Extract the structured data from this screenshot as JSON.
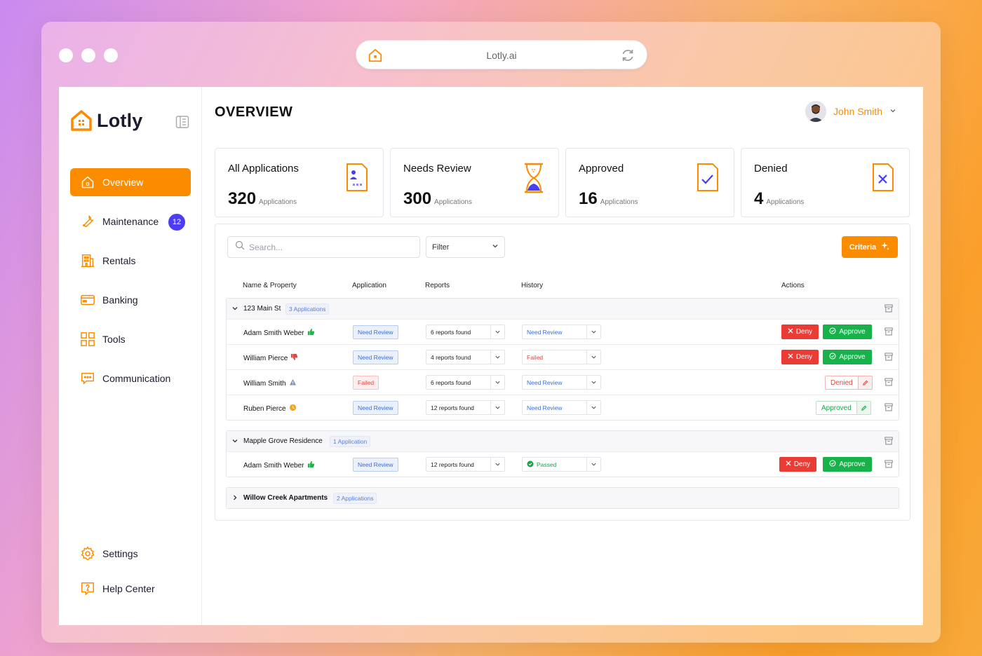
{
  "browser": {
    "url": "Lotly.ai"
  },
  "brand": {
    "name": "Lotly",
    "accent": "#fb8c00"
  },
  "sidebar": {
    "items": [
      {
        "label": "Overview",
        "icon": "home-icon",
        "active": true
      },
      {
        "label": "Maintenance",
        "icon": "wrench-icon",
        "badge": "12"
      },
      {
        "label": "Rentals",
        "icon": "building-icon"
      },
      {
        "label": "Banking",
        "icon": "card-icon"
      },
      {
        "label": "Tools",
        "icon": "grid-icon"
      },
      {
        "label": "Communication",
        "icon": "chat-icon"
      }
    ],
    "bottom": [
      {
        "label": "Settings",
        "icon": "gear-icon"
      },
      {
        "label": "Help Center",
        "icon": "help-icon"
      }
    ]
  },
  "header": {
    "title": "OVERVIEW",
    "user_name": "John Smith"
  },
  "stats": [
    {
      "label": "All Applications",
      "value": "320",
      "unit": "Applications",
      "icon": "document-user-icon"
    },
    {
      "label": "Needs Review",
      "value": "300",
      "unit": "Applications",
      "icon": "hourglass-icon"
    },
    {
      "label": "Approved",
      "value": "16",
      "unit": "Applications",
      "icon": "document-check-icon"
    },
    {
      "label": "Denied",
      "value": "4",
      "unit": "Applications",
      "icon": "document-x-icon"
    }
  ],
  "toolbar": {
    "search_placeholder": "Search...",
    "filter_label": "Filter",
    "criteria_label": "Criteria"
  },
  "table": {
    "headers": {
      "name": "Name & Property",
      "application": "Application",
      "reports": "Reports",
      "history": "History",
      "actions": "Actions"
    },
    "deny_label": "Deny",
    "approve_label": "Approve",
    "groups": [
      {
        "name": "123 Main St",
        "count": "3 Applications",
        "rows": [
          {
            "name": "Adam Smith Weber",
            "app": "Need Review",
            "reports": "6 reports found",
            "history": "Need Review",
            "action": "buttons"
          },
          {
            "name": "William Pierce",
            "app": "Need Review",
            "reports": "4 reports found",
            "history": "Failed",
            "action": "buttons"
          },
          {
            "name": "William Smith",
            "app": "Failed",
            "reports": "6 reports found",
            "history": "Need Review",
            "action": "Denied"
          },
          {
            "name": "Ruben Pierce",
            "app": "Need Review",
            "reports": "12 reports found",
            "history": "Need Review",
            "action": "Approved"
          }
        ]
      },
      {
        "name": "Mapple Grove Residence",
        "count": "1 Application",
        "rows": [
          {
            "name": "Adam Smith Weber",
            "app": "Need Review",
            "reports": "12 reports found",
            "history": "Passed",
            "action": "buttons"
          }
        ]
      },
      {
        "name": "Willow Creek Apartments",
        "count": "2 Applications",
        "rows": []
      }
    ]
  }
}
